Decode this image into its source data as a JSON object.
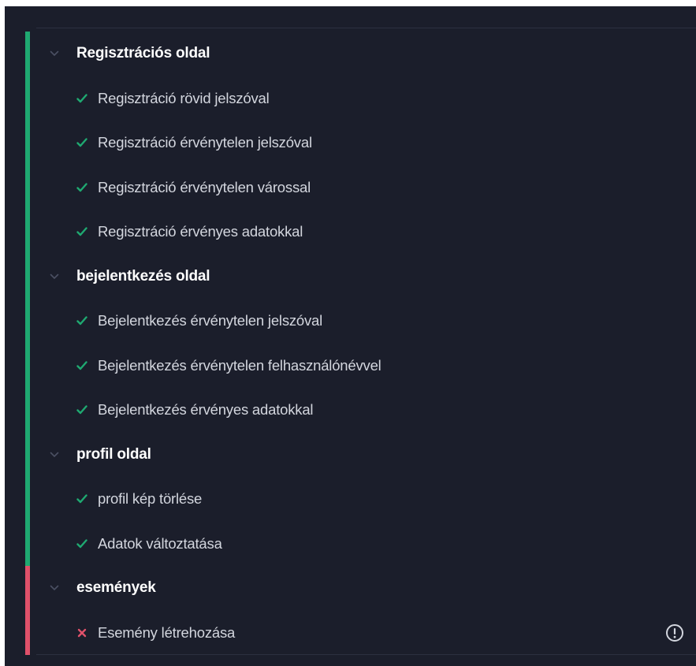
{
  "suites": [
    {
      "title": "Regisztrációs oldal",
      "status": "passed",
      "tests": [
        {
          "label": "Regisztráció rövid jelszóval",
          "status": "passed"
        },
        {
          "label": "Regisztráció érvénytelen jelszóval",
          "status": "passed"
        },
        {
          "label": "Regisztráció érvénytelen várossal",
          "status": "passed"
        },
        {
          "label": "Regisztráció érvényes adatokkal",
          "status": "passed"
        }
      ]
    },
    {
      "title": "bejelentkezés oldal",
      "status": "passed",
      "tests": [
        {
          "label": "Bejelentkezés érvénytelen jelszóval",
          "status": "passed"
        },
        {
          "label": "Bejelentkezés érvénytelen felhasználónévvel",
          "status": "passed"
        },
        {
          "label": "Bejelentkezés érvényes adatokkal",
          "status": "passed"
        }
      ]
    },
    {
      "title": "profil oldal",
      "status": "passed",
      "tests": [
        {
          "label": "profil kép törlése",
          "status": "passed"
        },
        {
          "label": "Adatok változtatása",
          "status": "passed"
        }
      ]
    },
    {
      "title": "események",
      "status": "failed",
      "tests": [
        {
          "label": "Esemény létrehozása",
          "status": "failed"
        }
      ]
    }
  ],
  "icons": {
    "suite_toggle": "chevron-down-icon",
    "passed": "checkmark-icon",
    "failed": "cross-icon",
    "error": "exclamation-circle-icon"
  },
  "colors": {
    "background": "#1b1e2b",
    "passed": "#1fa971",
    "failed": "#e0516a",
    "heading_text": "#ffffff",
    "test_text": "#d3d6de"
  }
}
